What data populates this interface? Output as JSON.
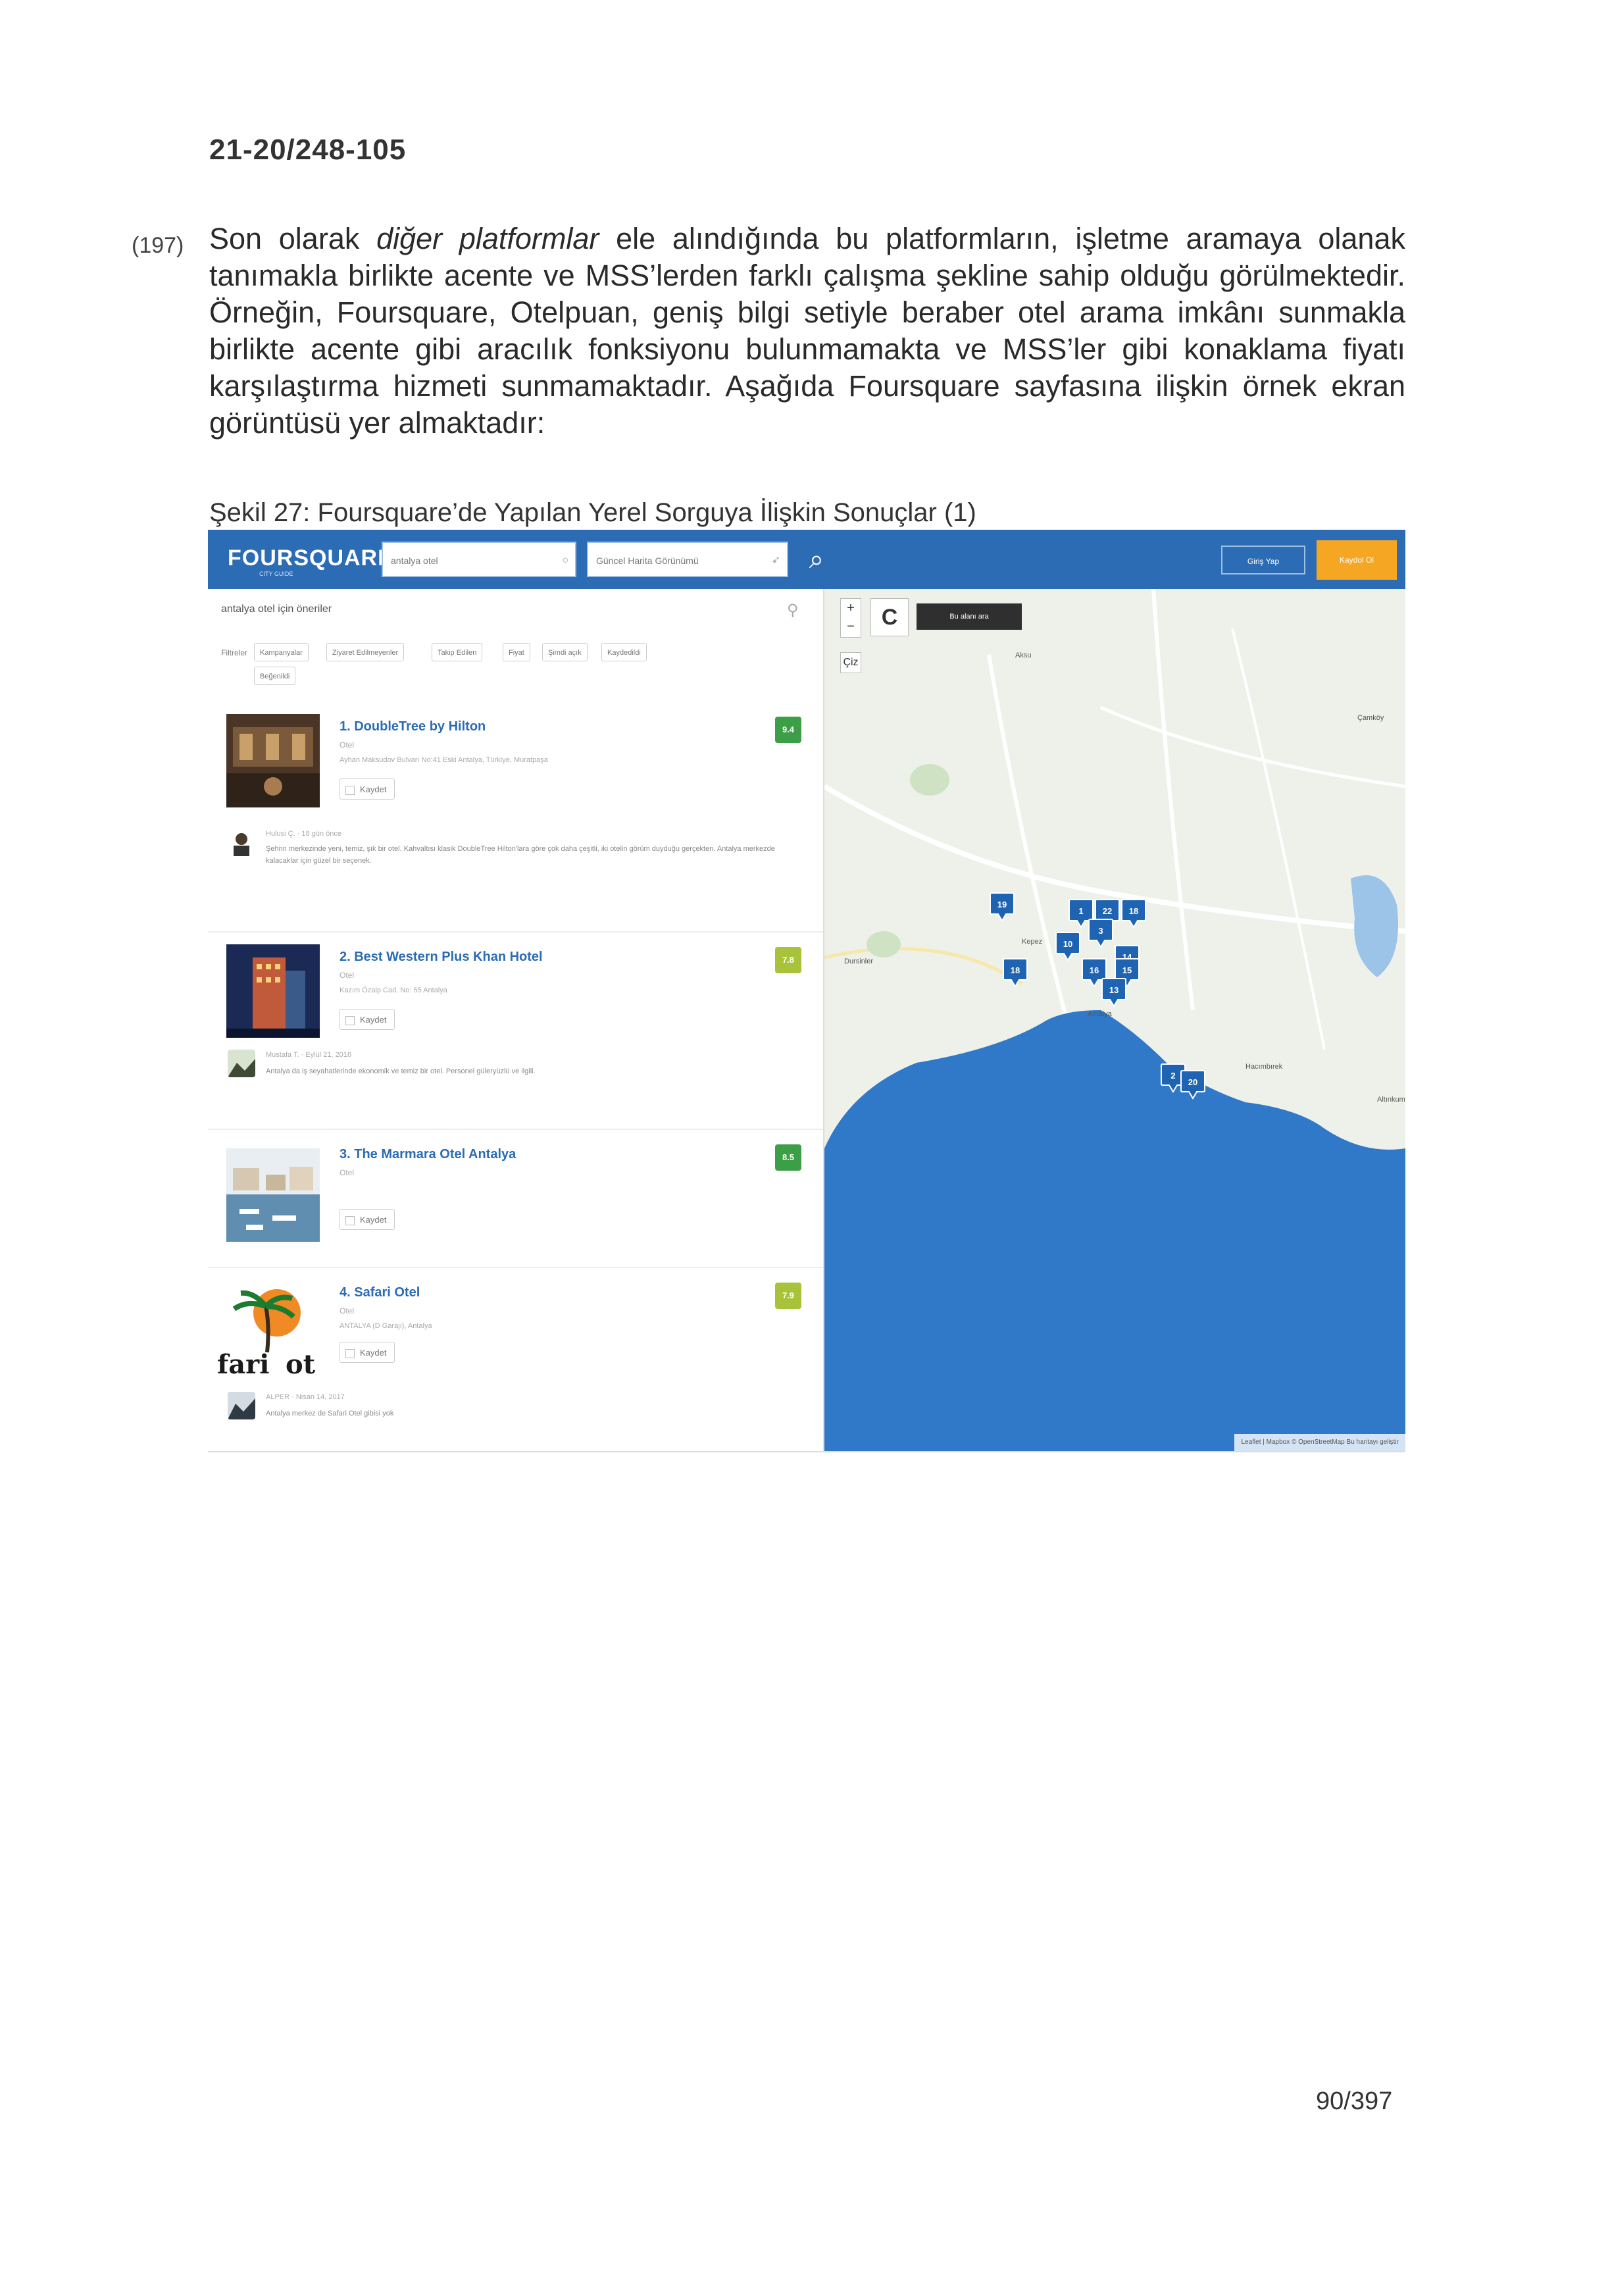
{
  "document": {
    "doc_number": "21-20/248-105",
    "paragraph": {
      "number": "(197)",
      "text_before_italic": "Son olarak ",
      "italic": "diğer platformlar",
      "text_after_italic": " ele alındığında bu platformların, işletme aramaya olanak tanımakla birlikte acente ve MSS’lerden farklı çalışma şekline sahip olduğu görülmektedir. Örneğin, Foursquare, Otelpuan, geniş bilgi setiyle beraber otel arama imkânı sunmakla birlikte acente gibi aracılık fonksiyonu bulunmamakta ve MSS’ler gibi konaklama fiyatı karşılaştırma hizmeti sunmamaktadır. Aşağıda Foursquare sayfasına ilişkin örnek ekran görüntüsü yer almaktadır:"
    },
    "caption": "Şekil 27: Foursquare’de Yapılan Yerel Sorguya İlişkin Sonuçlar (1)",
    "page_number": "90/397"
  },
  "app": {
    "logo": "FOURSQUARE",
    "logo_sub": "CITY GUIDE",
    "search_query": "antalya otel",
    "location_query": "Güncel Harita Görünümü",
    "login_label": "Giriş Yap",
    "signup_label": "Kaydol Ol",
    "colors": {
      "brand": "#2b6cb5",
      "signup": "#f5a623",
      "sea": "#2f79c8",
      "land": "#eef0ea"
    }
  },
  "results": {
    "suggestions_heading": "antalya otel için öneriler",
    "filters_label": "Filtreler",
    "filters": [
      "Kampanyalar",
      "Ziyaret Edilmeyenler",
      "Takip Edilen",
      "Fiyat",
      "Şimdi açık",
      "Kaydedildi",
      "Beğenildi"
    ],
    "save_label": "Kaydet",
    "venues": [
      {
        "title": "1. DoubleTree by Hilton",
        "category": "Otel",
        "address": "Ayhan Maksudov Bulvarı No:41 Eski Antalya, Türkiye, Muratpaşa",
        "score": "9.4",
        "score_color": "#3c9e47",
        "tip_meta": "Hulusi Ç. · 18 gün önce",
        "tip_text": "Şehrin merkezinde yeni, temiz, şık bir otel. Kahvaltısı klasik DoubleTree Hilton'lara göre çok daha çeşitli, iki otelin görüm duyduğu gerçekten. Antalya merkezde kalacaklar için güzel bir seçenek."
      },
      {
        "title": "2. Best Western Plus Khan Hotel",
        "category": "Otel",
        "address": "Kazım Özalp Cad. No: 55 Antalya",
        "score": "7.8",
        "score_color": "#a8c23a",
        "tip_meta": "Mustafa T. · Eylül 21, 2016",
        "tip_text": "Antalya da iş seyahatlerinde ekonomik ve temiz bir otel. Personel güleryüzlü ve ilgili."
      },
      {
        "title": "3. The Marmara Otel Antalya",
        "category": "Otel",
        "address": "",
        "score": "8.5",
        "score_color": "#3c9e47",
        "tip_meta": "",
        "tip_text": ""
      },
      {
        "title": "4. Safari Otel",
        "category": "Otel",
        "address": "ANTALYA (D Garajı), Antalya",
        "score": "7.9",
        "score_color": "#a8c23a",
        "tip_meta": "ALPER · Nisan 14, 2017",
        "tip_text": "Antalya merkez de Safari Otel gibisi yok"
      }
    ]
  },
  "map": {
    "search_area_label": "Bu alanı ara",
    "zoom_in": "+",
    "zoom_out": "−",
    "rotate_label": "Çiz",
    "labels": [
      "Aksu",
      "Kepez",
      "Antalya",
      "Dursinler",
      "Hacımbırek",
      "Çamköy",
      "Altınkum"
    ],
    "pins": [
      "19",
      "1",
      "22",
      "18",
      "10",
      "3",
      "18",
      "14",
      "16",
      "15",
      "13",
      "2",
      "20"
    ],
    "attribution": "Leaflet | Mapbox © OpenStreetMap Bu haritayı geliştir"
  }
}
